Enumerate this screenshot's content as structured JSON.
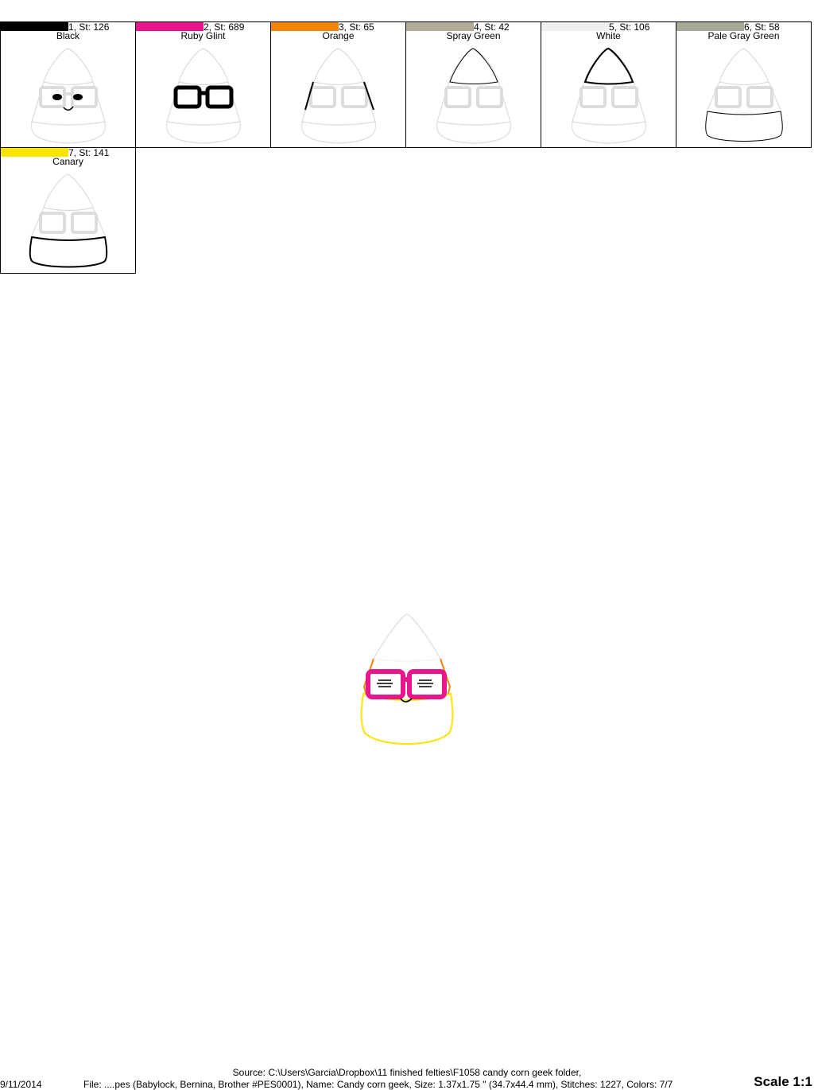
{
  "colors": [
    {
      "stitch_label": "1, St: 126",
      "name": "Black",
      "hex": "#000000"
    },
    {
      "stitch_label": "2, St: 689",
      "name": "Ruby Glint",
      "hex": "#e8168c"
    },
    {
      "stitch_label": "3, St: 65",
      "name": "Orange",
      "hex": "#f5850a"
    },
    {
      "stitch_label": "4, St: 42",
      "name": "Spray Green",
      "hex": "#b3ac98"
    },
    {
      "stitch_label": "5, St: 106",
      "name": "White",
      "hex": "#efefef"
    },
    {
      "stitch_label": "6, St: 58",
      "name": "Pale Gray Green",
      "hex": "#a7a896"
    },
    {
      "stitch_label": "7, St: 141",
      "name": "Canary",
      "hex": "#fae400"
    }
  ],
  "footer": {
    "source": "Source: C:\\Users\\Garcia\\Dropbox\\11 finished felties\\F1058 candy corn geek folder,",
    "date": "9/11/2014",
    "file_info": "File: ....pes (Babylock, Bernina, Brother #PES0001), Name: Candy corn geek, Size: 1.37x1.75 \" (34.7x44.4 mm), Stitches: 1227, Colors: 7/7",
    "scale": "Scale 1:1"
  }
}
